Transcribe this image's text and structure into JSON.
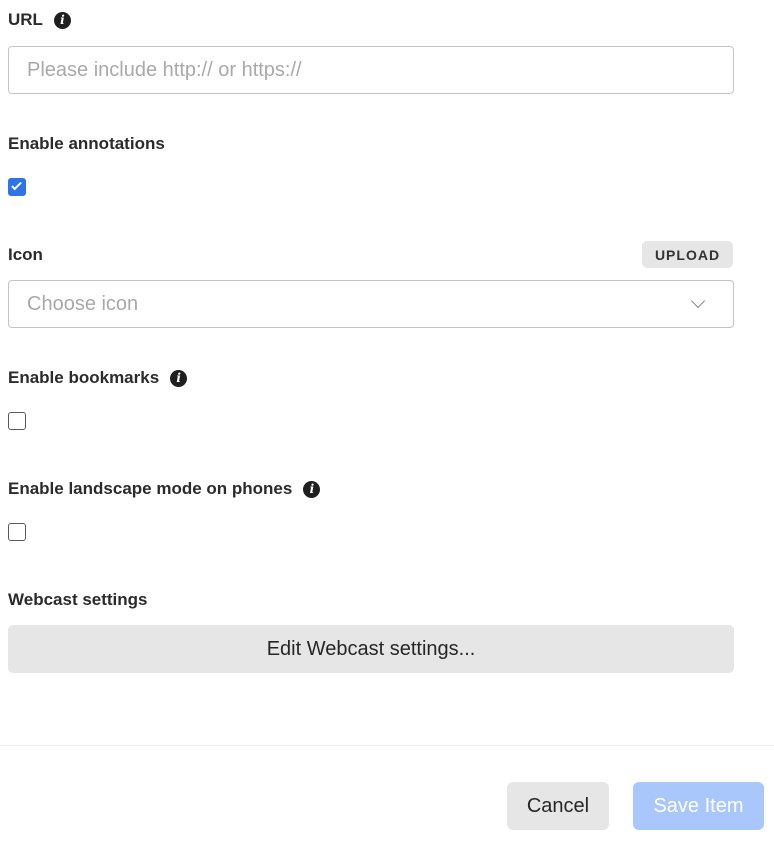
{
  "url_field": {
    "label": "URL",
    "info_icon": "info-icon",
    "value": "",
    "placeholder": "Please include http:// or https://"
  },
  "annotations": {
    "label": "Enable annotations",
    "checked": true
  },
  "icon_field": {
    "label": "Icon",
    "upload_label": "UPLOAD",
    "placeholder": "Choose icon",
    "dropdown_icon": "chevron-down-icon"
  },
  "bookmarks": {
    "label": "Enable bookmarks",
    "info_icon": "info-icon",
    "checked": false
  },
  "landscape": {
    "label": "Enable landscape mode on phones",
    "info_icon": "info-icon",
    "checked": false
  },
  "webcast": {
    "label": "Webcast settings",
    "button_label": "Edit Webcast settings..."
  },
  "footer": {
    "cancel_label": "Cancel",
    "save_label": "Save Item",
    "save_disabled": true
  },
  "colors": {
    "accent": "#2f74e6",
    "save_disabled_bg": "#a9c7fb",
    "button_gray": "#e6e6e7"
  }
}
